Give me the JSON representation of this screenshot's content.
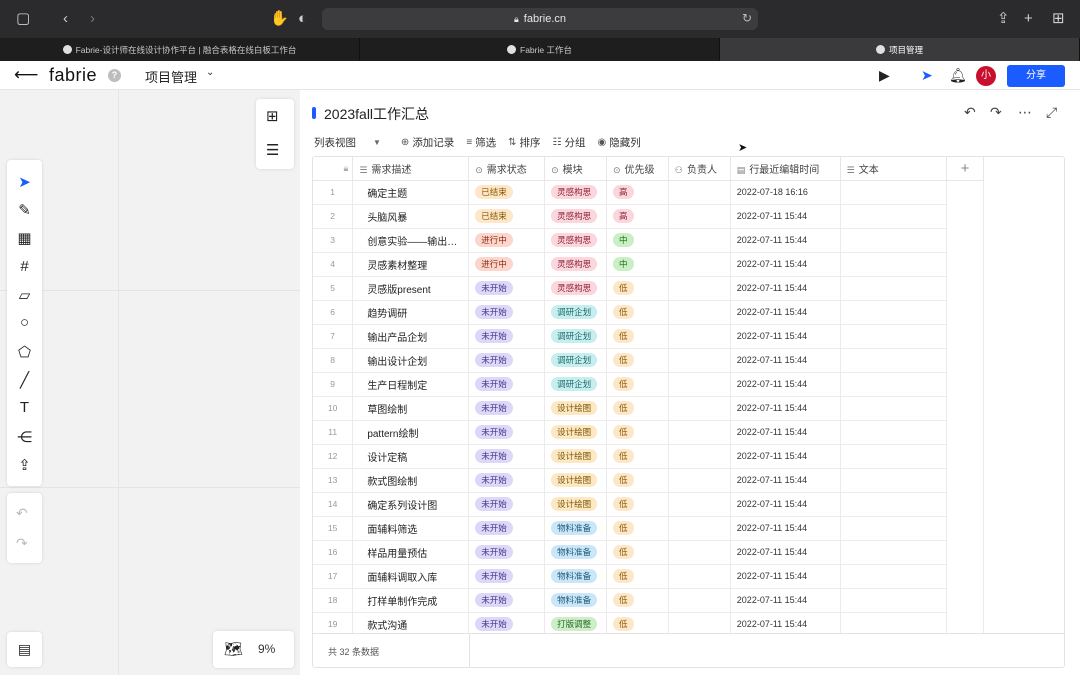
{
  "browser": {
    "url": "fabrie.cn",
    "tabs": [
      {
        "label": "Fabrie-设计师在线设计协作平台 | 融合表格在线白板工作台",
        "active": false
      },
      {
        "label": "Fabrie 工作台",
        "active": false
      },
      {
        "label": "项目管理",
        "active": true
      }
    ]
  },
  "header": {
    "logo": "fabrie",
    "help": "?",
    "project_name": "项目管理",
    "avatar": "小",
    "share_label": "分享",
    "share_color": "#1a5cff"
  },
  "canvas": {
    "zoom": "9%"
  },
  "table": {
    "title": "2023fall工作汇总",
    "toolbar": {
      "view": "列表视图",
      "add_record": "添加记录",
      "filter": "筛选",
      "sort": "排序",
      "group": "分组",
      "hide_columns": "隐藏列"
    },
    "columns": [
      "需求描述",
      "需求状态",
      "模块",
      "优先级",
      "负责人",
      "行最近编辑时间",
      "文本"
    ],
    "rows": [
      {
        "n": "1",
        "desc": "确定主题",
        "status": "已结束",
        "module": "灵感构思",
        "priority": "高",
        "owner": "",
        "time": "2022-07-18 16:16",
        "text": ""
      },
      {
        "n": "2",
        "desc": "头脑风暴",
        "status": "已结束",
        "module": "灵感构思",
        "priority": "高",
        "owner": "",
        "time": "2022-07-11 15:44",
        "text": ""
      },
      {
        "n": "3",
        "desc": "创意实验——输出…",
        "status": "进行中",
        "module": "灵感构思",
        "priority": "中",
        "owner": "",
        "time": "2022-07-11 15:44",
        "text": ""
      },
      {
        "n": "4",
        "desc": "灵感素材整理",
        "status": "进行中",
        "module": "灵感构思",
        "priority": "中",
        "owner": "",
        "time": "2022-07-11 15:44",
        "text": ""
      },
      {
        "n": "5",
        "desc": "灵感版present",
        "status": "未开始",
        "module": "灵感构思",
        "priority": "低",
        "owner": "",
        "time": "2022-07-11 15:44",
        "text": ""
      },
      {
        "n": "6",
        "desc": "趋势调研",
        "status": "未开始",
        "module": "调研企划",
        "priority": "低",
        "owner": "",
        "time": "2022-07-11 15:44",
        "text": ""
      },
      {
        "n": "7",
        "desc": "输出产品企划",
        "status": "未开始",
        "module": "调研企划",
        "priority": "低",
        "owner": "",
        "time": "2022-07-11 15:44",
        "text": ""
      },
      {
        "n": "8",
        "desc": "输出设计企划",
        "status": "未开始",
        "module": "调研企划",
        "priority": "低",
        "owner": "",
        "time": "2022-07-11 15:44",
        "text": ""
      },
      {
        "n": "9",
        "desc": "生产日程制定",
        "status": "未开始",
        "module": "调研企划",
        "priority": "低",
        "owner": "",
        "time": "2022-07-11 15:44",
        "text": ""
      },
      {
        "n": "10",
        "desc": "草图绘制",
        "status": "未开始",
        "module": "设计绘图",
        "priority": "低",
        "owner": "",
        "time": "2022-07-11 15:44",
        "text": ""
      },
      {
        "n": "11",
        "desc": "pattern绘制",
        "status": "未开始",
        "module": "设计绘图",
        "priority": "低",
        "owner": "",
        "time": "2022-07-11 15:44",
        "text": ""
      },
      {
        "n": "12",
        "desc": "设计定稿",
        "status": "未开始",
        "module": "设计绘图",
        "priority": "低",
        "owner": "",
        "time": "2022-07-11 15:44",
        "text": ""
      },
      {
        "n": "13",
        "desc": "款式图绘制",
        "status": "未开始",
        "module": "设计绘图",
        "priority": "低",
        "owner": "",
        "time": "2022-07-11 15:44",
        "text": ""
      },
      {
        "n": "14",
        "desc": "确定系列设计图",
        "status": "未开始",
        "module": "设计绘图",
        "priority": "低",
        "owner": "",
        "time": "2022-07-11 15:44",
        "text": ""
      },
      {
        "n": "15",
        "desc": "面辅料筛选",
        "status": "未开始",
        "module": "物料准备",
        "priority": "低",
        "owner": "",
        "time": "2022-07-11 15:44",
        "text": ""
      },
      {
        "n": "16",
        "desc": "样品用量预估",
        "status": "未开始",
        "module": "物料准备",
        "priority": "低",
        "owner": "",
        "time": "2022-07-11 15:44",
        "text": ""
      },
      {
        "n": "17",
        "desc": "面辅料调取入库",
        "status": "未开始",
        "module": "物料准备",
        "priority": "低",
        "owner": "",
        "time": "2022-07-11 15:44",
        "text": ""
      },
      {
        "n": "18",
        "desc": "打样单制作完成",
        "status": "未开始",
        "module": "物料准备",
        "priority": "低",
        "owner": "",
        "time": "2022-07-11 15:44",
        "text": ""
      },
      {
        "n": "19",
        "desc": "款式沟通",
        "status": "未开始",
        "module": "打版调整",
        "priority": "低",
        "owner": "",
        "time": "2022-07-11 15:44",
        "text": ""
      }
    ],
    "footer": "共 32 条数据"
  },
  "tag_colors": {
    "已结束": {
      "bg": "#fde7c8",
      "fg": "#8a5a00"
    },
    "进行中": {
      "bg": "#fcd6cc",
      "fg": "#8a2c14"
    },
    "未开始": {
      "bg": "#ddd8f7",
      "fg": "#40358a"
    },
    "灵感构思": {
      "bg": "#fbd6dc",
      "fg": "#8a2036"
    },
    "调研企划": {
      "bg": "#c7eeee",
      "fg": "#1f6b6b"
    },
    "设计绘图": {
      "bg": "#fce8c2",
      "fg": "#7a5200"
    },
    "物料准备": {
      "bg": "#cbe7f7",
      "fg": "#1c5a80"
    },
    "打版调整": {
      "bg": "#cdeec9",
      "fg": "#266b20"
    },
    "高": {
      "bg": "#fbd6dc",
      "fg": "#8a2036"
    },
    "中": {
      "bg": "#c9efc4",
      "fg": "#266b20"
    },
    "低": {
      "bg": "#fde7c8",
      "fg": "#8a5a00"
    }
  }
}
